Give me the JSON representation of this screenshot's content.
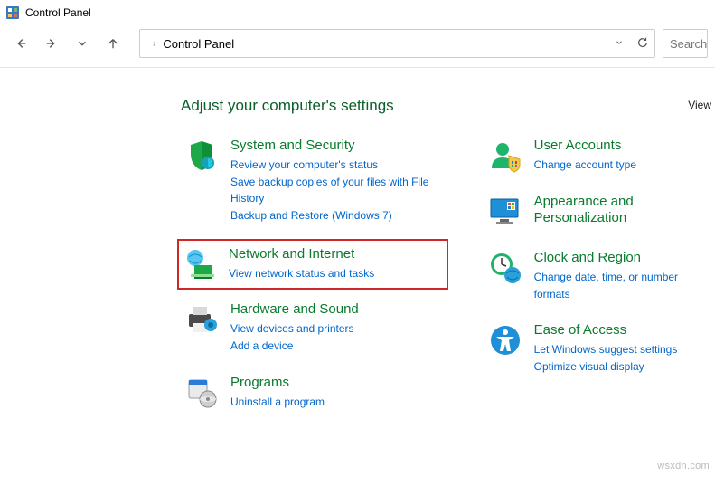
{
  "titlebar": {
    "text": "Control Panel"
  },
  "address": {
    "location": "Control Panel",
    "search_placeholder": "Search"
  },
  "main": {
    "heading": "Adjust your computer's settings",
    "view_by_label": "View"
  },
  "left_categories": [
    {
      "title": "System and Security",
      "links": [
        "Review your computer's status",
        "Save backup copies of your files with File History",
        "Backup and Restore (Windows 7)"
      ]
    },
    {
      "title": "Network and Internet",
      "links": [
        "View network status and tasks"
      ],
      "highlighted": true
    },
    {
      "title": "Hardware and Sound",
      "links": [
        "View devices and printers",
        "Add a device"
      ]
    },
    {
      "title": "Programs",
      "links": [
        "Uninstall a program"
      ]
    }
  ],
  "right_categories": [
    {
      "title": "User Accounts",
      "links": [
        "Change account type"
      ]
    },
    {
      "title": "Appearance and Personalization",
      "links": []
    },
    {
      "title": "Clock and Region",
      "links": [
        "Change date, time, or number formats"
      ]
    },
    {
      "title": "Ease of Access",
      "links": [
        "Let Windows suggest settings",
        "Optimize visual display"
      ]
    }
  ],
  "watermark": "wsxdn.com"
}
